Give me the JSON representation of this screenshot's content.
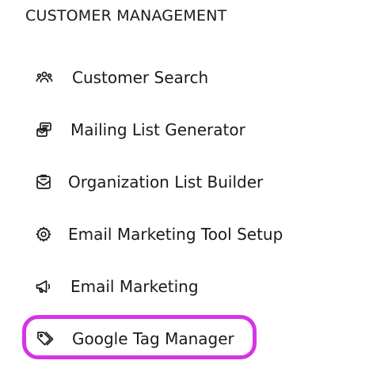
{
  "section": {
    "title": "CUSTOMER MANAGEMENT"
  },
  "menu": {
    "items": [
      {
        "label": "Customer Search",
        "icon": "users-icon"
      },
      {
        "label": "Mailing List Generator",
        "icon": "mail-list-icon"
      },
      {
        "label": "Organization List Builder",
        "icon": "clipboard-mail-icon"
      },
      {
        "label": "Email Marketing Tool Setup",
        "icon": "gear-icon"
      },
      {
        "label": "Email Marketing",
        "icon": "megaphone-icon"
      },
      {
        "label": "Google Tag Manager",
        "icon": "tag-icon"
      }
    ],
    "highlighted_item": "Google Tag Manager"
  },
  "colors": {
    "text": "#1a1a1a",
    "highlight_border": "#d633e6",
    "background": "#ffffff"
  }
}
